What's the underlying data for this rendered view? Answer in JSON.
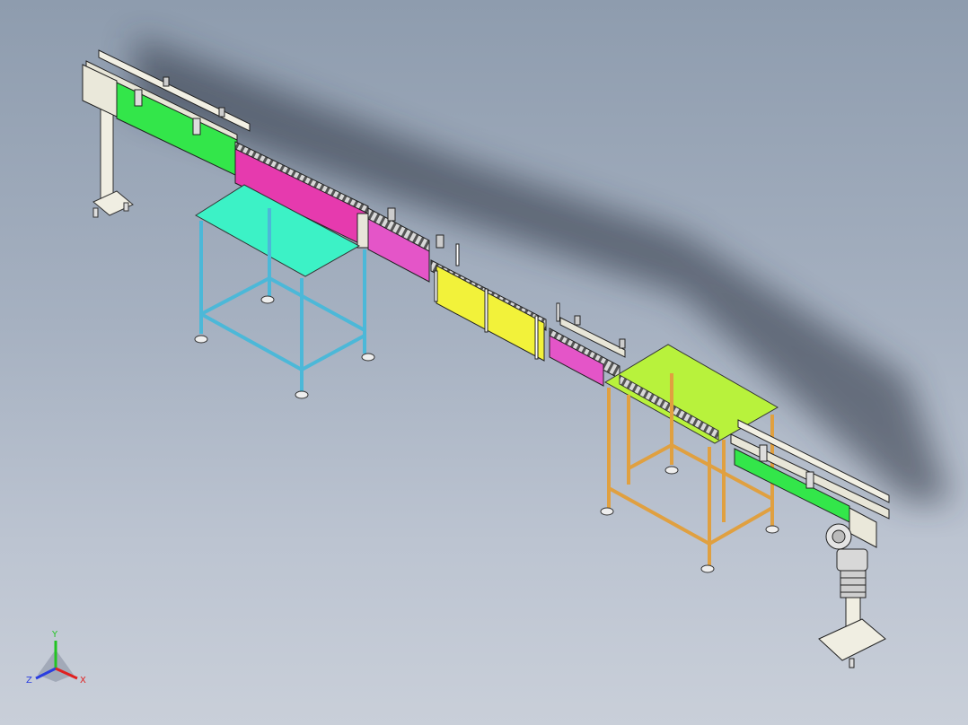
{
  "viewport": {
    "background_top": "#8e9cae",
    "background_bottom": "#c9cfd9"
  },
  "model": {
    "colors": {
      "conveyor_green": "#33e64a",
      "conveyor_magenta": "#e63aae",
      "conveyor_pink": "#e455c8",
      "conveyor_yellow": "#f2f23a",
      "table_left_top": "#3cf2c6",
      "table_left_frame": "#4cb8d8",
      "table_right_top": "#b8f23c",
      "table_right_frame": "#e0a040",
      "support_stand": "#f0eee2",
      "motor": "#d8d8d8"
    }
  },
  "triad": {
    "y_label": "Y",
    "z_label": "Z",
    "x_label": "X",
    "y_color": "#22c422",
    "z_color": "#2a3ee0",
    "x_color": "#e02020"
  }
}
